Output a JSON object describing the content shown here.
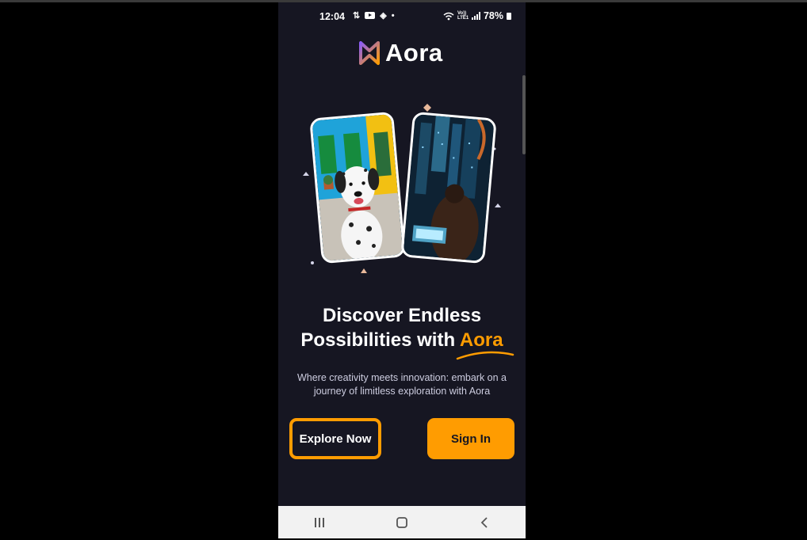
{
  "status_bar": {
    "time": "12:04",
    "signal_text": "Vo)) LTE1",
    "battery": "78%",
    "icons": [
      "sync-icon",
      "youtube-icon",
      "vpn-icon",
      "dot-icon",
      "wifi-icon",
      "signal-icon",
      "battery-icon"
    ]
  },
  "app": {
    "name": "Aora"
  },
  "hero": {
    "headline_line1": "Discover Endless",
    "headline_line2_prefix": "Possibilities with ",
    "headline_accent": "Aora",
    "subtext": "Where creativity meets innovation: embark on a journey of limitless exploration with Aora"
  },
  "buttons": {
    "explore": "Explore Now",
    "signin": "Sign In"
  },
  "nav": {
    "recents_icon": "recents-icon",
    "home_icon": "home-icon",
    "back_icon": "back-icon"
  },
  "colors": {
    "background": "#161622",
    "accent": "#ff9c01",
    "logo_gradient": [
      "#8b5cf6",
      "#ff9c01"
    ]
  }
}
